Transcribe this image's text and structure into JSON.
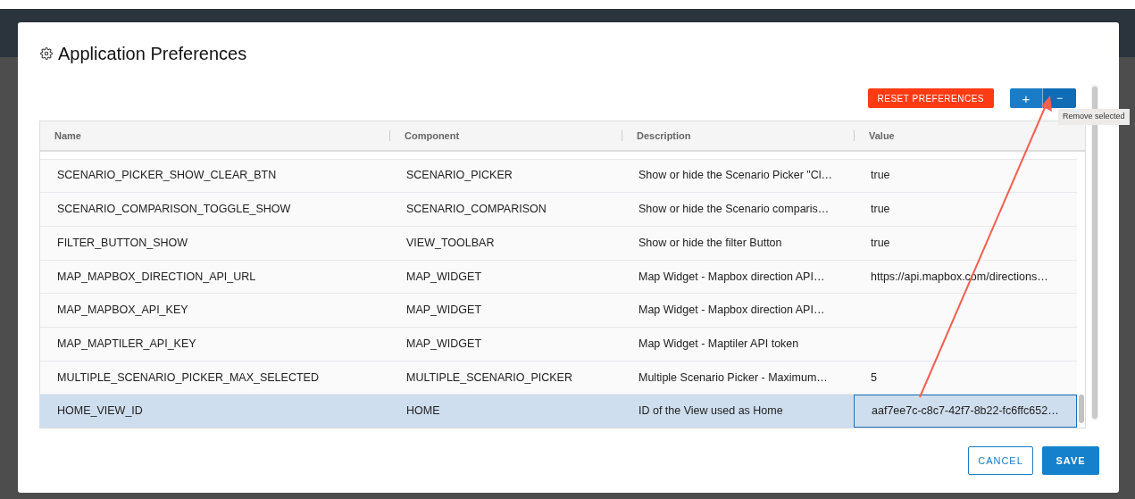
{
  "dialog": {
    "title": "Application Preferences"
  },
  "toolbar": {
    "reset_button": "RESET PREFERENCES",
    "add_button": "+",
    "remove_button": "−",
    "tooltip": "Remove selected"
  },
  "table": {
    "columns": [
      "Name",
      "Component",
      "Description",
      "Value"
    ],
    "rows": [
      {
        "cells": [
          "SCENARIO_PICKER_SHOW_CLEAR_BTN",
          "SCENARIO_PICKER",
          "Show or hide the Scenario Picker \"Cl…",
          "true"
        ],
        "selected": false
      },
      {
        "cells": [
          "SCENARIO_COMPARISON_TOGGLE_SHOW",
          "SCENARIO_COMPARISON",
          "Show or hide the Scenario comparis…",
          "true"
        ],
        "selected": false
      },
      {
        "cells": [
          "FILTER_BUTTON_SHOW",
          "VIEW_TOOLBAR",
          "Show or hide the filter Button",
          "true"
        ],
        "selected": false
      },
      {
        "cells": [
          "MAP_MAPBOX_DIRECTION_API_URL",
          "MAP_WIDGET",
          "Map Widget - Mapbox direction API…",
          "https://api.mapbox.com/directions…"
        ],
        "selected": false
      },
      {
        "cells": [
          "MAP_MAPBOX_API_KEY",
          "MAP_WIDGET",
          "Map Widget - Mapbox direction API…",
          ""
        ],
        "selected": false
      },
      {
        "cells": [
          "MAP_MAPTILER_API_KEY",
          "MAP_WIDGET",
          "Map Widget - Maptiler API token",
          ""
        ],
        "selected": false
      },
      {
        "cells": [
          "MULTIPLE_SCENARIO_PICKER_MAX_SELECTED",
          "MULTIPLE_SCENARIO_PICKER",
          "Multiple Scenario Picker - Maximum…",
          "5"
        ],
        "selected": false
      },
      {
        "cells": [
          "HOME_VIEW_ID",
          "HOME",
          "ID of the View used as Home",
          "aaf7ee7c-c8c7-42f7-8b22-fc6ffc652…"
        ],
        "selected": true
      }
    ]
  },
  "footer": {
    "cancel_button": "CANCEL",
    "save_button": "SAVE"
  }
}
